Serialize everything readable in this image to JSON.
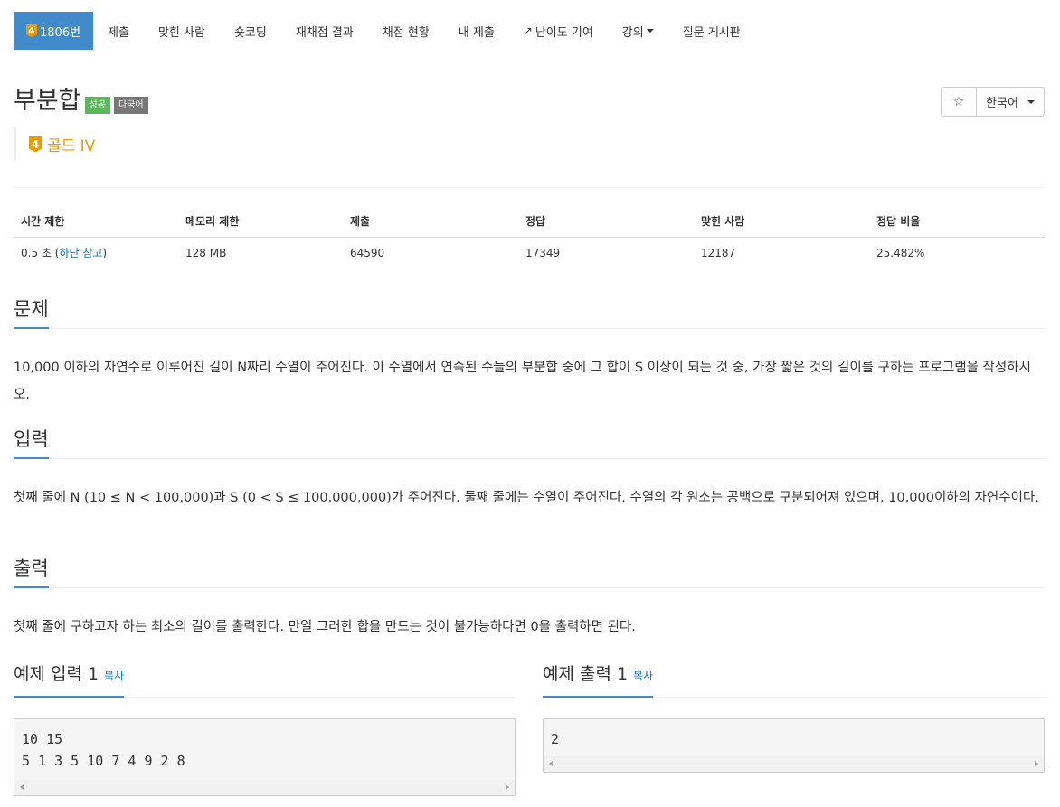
{
  "nav": {
    "problem_tier": "4",
    "problem_id": "1806번",
    "items": [
      "제출",
      "맞힌 사람",
      "숏코딩",
      "재채점 결과",
      "채점 현황",
      "내 제출",
      "난이도 기여",
      "강의",
      "질문 게시판"
    ]
  },
  "title": {
    "text": "부분합",
    "label_success": "성공",
    "label_multilang": "다국어"
  },
  "language": {
    "star": "☆",
    "selected": "한국어"
  },
  "tier": {
    "badge": "4",
    "text": "골드 IV"
  },
  "info": {
    "headers": [
      "시간 제한",
      "메모리 제한",
      "제출",
      "정답",
      "맞힌 사람",
      "정답 비율"
    ],
    "time_value": "0.5 초 (",
    "time_link": "하단 참고",
    "time_close": ")",
    "memory": "128 MB",
    "submissions": "64590",
    "accepted": "17349",
    "solvers": "12187",
    "ratio": "25.482%"
  },
  "sections": {
    "problem_title": "문제",
    "problem_text": "10,000 이하의 자연수로 이루어진 길이 N짜리 수열이 주어진다. 이 수열에서 연속된 수들의 부분합 중에 그 합이 S 이상이 되는 것 중, 가장 짧은 것의 길이를 구하는 프로그램을 작성하시오.",
    "input_title": "입력",
    "input_text": "첫째 줄에 N (10 ≤ N < 100,000)과 S (0 < S ≤ 100,000,000)가 주어진다. 둘째 줄에는 수열이 주어진다. 수열의 각 원소는 공백으로 구분되어져 있으며, 10,000이하의 자연수이다.",
    "output_title": "출력",
    "output_text": "첫째 줄에 구하고자 하는 최소의 길이를 출력한다. 만일 그러한 합을 만드는 것이 불가능하다면 0을 출력하면 된다."
  },
  "samples": {
    "input_title": "예제 입력 1",
    "output_title": "예제 출력 1",
    "copy": "복사",
    "input": "10 15\n5 1 3 5 10 7 4 9 2 8",
    "output": "2"
  }
}
